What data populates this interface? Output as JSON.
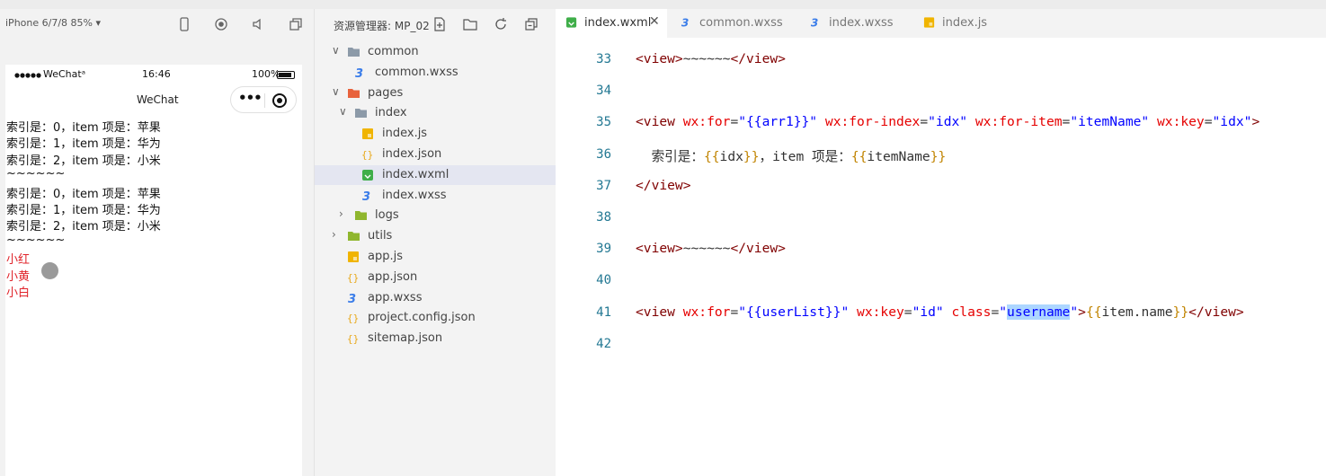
{
  "simulator": {
    "device": "iPhone 6/7/8 85% ▾",
    "status": {
      "carrier": "WeChatᵃ",
      "time": "16:46",
      "battery": "100%"
    },
    "nav_title": "WeChat",
    "lines": [
      {
        "text": "索引是：0，item 项是：苹果",
        "red": false
      },
      {
        "text": "索引是：1，item 项是：华为",
        "red": false
      },
      {
        "text": "索引是：2，item 项是：小米",
        "red": false
      },
      {
        "text": "~~~~~~",
        "red": false
      },
      {
        "text": "索引是：0，item 项是：苹果",
        "red": false
      },
      {
        "text": "索引是：1，item 项是：华为",
        "red": false
      },
      {
        "text": "索引是：2，item 项是：小米",
        "red": false
      },
      {
        "text": "~~~~~~",
        "red": false
      },
      {
        "text": "小红",
        "red": true
      },
      {
        "text": "小黄",
        "red": true
      },
      {
        "text": "小白",
        "red": true
      }
    ]
  },
  "explorer": {
    "title": "资源管理器: MP_02",
    "tree": [
      {
        "name": "common",
        "kind": "folder",
        "chev": "∨"
      },
      {
        "name": "common.wxss",
        "kind": "wxss",
        "chev": ""
      },
      {
        "name": "pages",
        "kind": "folder-pages",
        "chev": "∨"
      },
      {
        "name": "index",
        "kind": "folder",
        "chev": "∨"
      },
      {
        "name": "index.js",
        "kind": "js",
        "chev": ""
      },
      {
        "name": "index.json",
        "kind": "json",
        "chev": ""
      },
      {
        "name": "index.wxml",
        "kind": "wxml",
        "chev": "",
        "selected": true
      },
      {
        "name": "index.wxss",
        "kind": "wxss",
        "chev": ""
      },
      {
        "name": "logs",
        "kind": "folder-logs",
        "chev": "›"
      },
      {
        "name": "utils",
        "kind": "folder-utils",
        "chev": "›"
      },
      {
        "name": "app.js",
        "kind": "js",
        "chev": ""
      },
      {
        "name": "app.json",
        "kind": "json",
        "chev": ""
      },
      {
        "name": "app.wxss",
        "kind": "wxss",
        "chev": ""
      },
      {
        "name": "project.config.json",
        "kind": "json",
        "chev": ""
      },
      {
        "name": "sitemap.json",
        "kind": "json",
        "chev": ""
      }
    ]
  },
  "tabs": [
    {
      "name": "index.wxml",
      "kind": "wxml",
      "active": true,
      "close": "✕"
    },
    {
      "name": "common.wxss",
      "kind": "wxss",
      "active": false
    },
    {
      "name": "index.wxss",
      "kind": "wxss",
      "active": false
    },
    {
      "name": "index.js",
      "kind": "js",
      "active": false
    }
  ],
  "editor": {
    "line_numbers": [
      "33",
      "34",
      "35",
      "36",
      "37",
      "38",
      "39",
      "40",
      "41",
      "42"
    ],
    "lines": [
      [
        {
          "t": "<view>",
          "c": "tg"
        },
        {
          "t": "~~~~~~",
          "c": "tx"
        },
        {
          "t": "</view>",
          "c": "tg"
        }
      ],
      [],
      [
        {
          "t": "<view ",
          "c": "tg"
        },
        {
          "t": "wx:for",
          "c": "at"
        },
        {
          "t": "=",
          "c": "tx"
        },
        {
          "t": "\"{{arr1}}\"",
          "c": "st"
        },
        {
          "t": " ",
          "c": "tx"
        },
        {
          "t": "wx:for-index",
          "c": "at"
        },
        {
          "t": "=",
          "c": "tx"
        },
        {
          "t": "\"idx\"",
          "c": "st"
        },
        {
          "t": " ",
          "c": "tx"
        },
        {
          "t": "wx:for-item",
          "c": "at"
        },
        {
          "t": "=",
          "c": "tx"
        },
        {
          "t": "\"itemName\"",
          "c": "st"
        },
        {
          "t": " ",
          "c": "tx"
        },
        {
          "t": "wx:key",
          "c": "at"
        },
        {
          "t": "=",
          "c": "tx"
        },
        {
          "t": "\"idx\"",
          "c": "st"
        },
        {
          "t": ">",
          "c": "tg"
        }
      ],
      [
        {
          "t": "  ",
          "c": "tx"
        },
        {
          "t": "索引是：",
          "c": "tx cjk"
        },
        {
          "t": "{{",
          "c": "br"
        },
        {
          "t": "idx",
          "c": "tx"
        },
        {
          "t": "}}",
          "c": "br"
        },
        {
          "t": "，",
          "c": "tx cjk"
        },
        {
          "t": "item ",
          "c": "tx"
        },
        {
          "t": "项是：",
          "c": "tx cjk"
        },
        {
          "t": "{{",
          "c": "br"
        },
        {
          "t": "itemName",
          "c": "tx"
        },
        {
          "t": "}}",
          "c": "br"
        }
      ],
      [
        {
          "t": "</view>",
          "c": "tg"
        }
      ],
      [],
      [
        {
          "t": "<view>",
          "c": "tg"
        },
        {
          "t": "~~~~~~",
          "c": "tx"
        },
        {
          "t": "</view>",
          "c": "tg"
        }
      ],
      [],
      [
        {
          "t": "<view ",
          "c": "tg"
        },
        {
          "t": "wx:for",
          "c": "at"
        },
        {
          "t": "=",
          "c": "tx"
        },
        {
          "t": "\"{{userList}}\"",
          "c": "st"
        },
        {
          "t": " ",
          "c": "tx"
        },
        {
          "t": "wx:key",
          "c": "at"
        },
        {
          "t": "=",
          "c": "tx"
        },
        {
          "t": "\"id\"",
          "c": "st"
        },
        {
          "t": " ",
          "c": "tx"
        },
        {
          "t": "class",
          "c": "at"
        },
        {
          "t": "=",
          "c": "tx"
        },
        {
          "t": "\"",
          "c": "st"
        },
        {
          "t": "username",
          "c": "st hl"
        },
        {
          "t": "\"",
          "c": "st"
        },
        {
          "t": ">",
          "c": "tg"
        },
        {
          "t": "{{",
          "c": "br"
        },
        {
          "t": "item.name",
          "c": "tx"
        },
        {
          "t": "}}",
          "c": "br"
        },
        {
          "t": "</view>",
          "c": "tg"
        }
      ],
      []
    ]
  },
  "colors": {
    "wxml_icon": "#3fae49",
    "wxss_icon": "#3b7de9",
    "js_icon": "#f0b400",
    "json_icon": "#e8a81a",
    "folder": "#8c9aa8",
    "folder_pages": "#e8623c",
    "folder_green": "#8fb62e",
    "selection": "#add6ff"
  }
}
